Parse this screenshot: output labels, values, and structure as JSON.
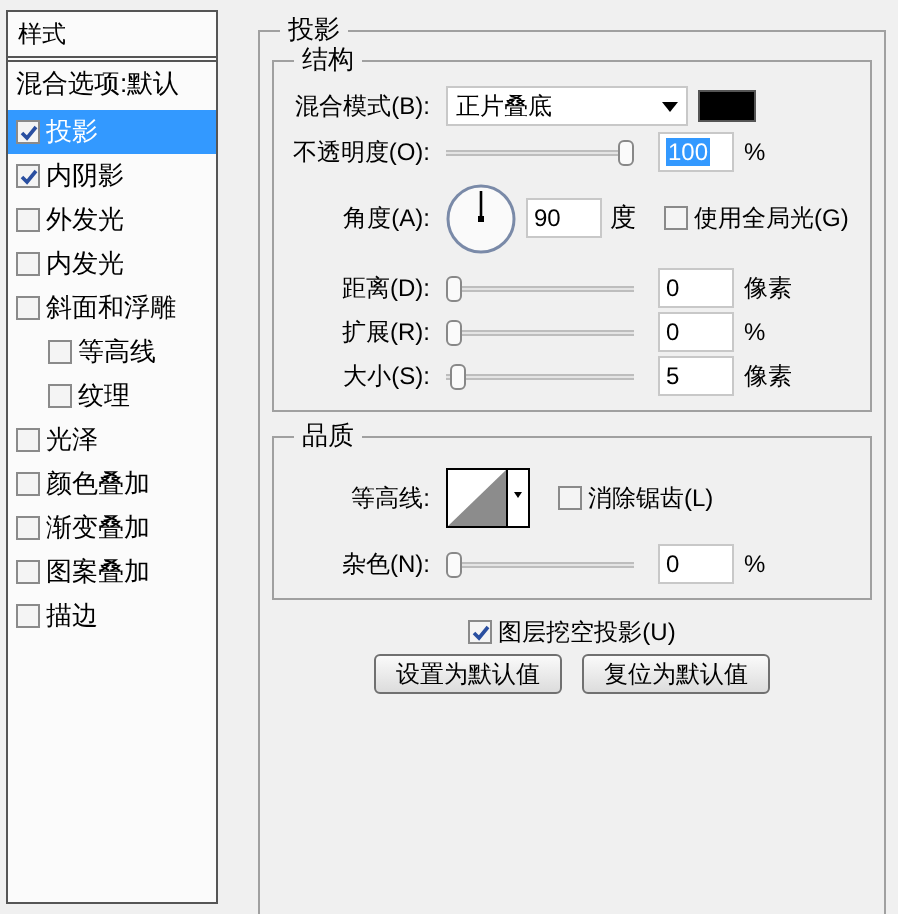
{
  "sidebar": {
    "header": "样式",
    "items": [
      {
        "label": "混合选项:默认",
        "kind": "plain",
        "selected": false
      },
      {
        "label": "投影",
        "kind": "check",
        "checked": true,
        "selected": true
      },
      {
        "label": "内阴影",
        "kind": "check",
        "checked": true,
        "selected": false
      },
      {
        "label": "外发光",
        "kind": "check",
        "checked": false,
        "selected": false
      },
      {
        "label": "内发光",
        "kind": "check",
        "checked": false,
        "selected": false
      },
      {
        "label": "斜面和浮雕",
        "kind": "check",
        "checked": false,
        "selected": false,
        "children": [
          {
            "label": "等高线",
            "kind": "check",
            "checked": false,
            "selected": false
          },
          {
            "label": "纹理",
            "kind": "check",
            "checked": false,
            "selected": false
          }
        ]
      },
      {
        "label": "光泽",
        "kind": "check",
        "checked": false,
        "selected": false
      },
      {
        "label": "颜色叠加",
        "kind": "check",
        "checked": false,
        "selected": false
      },
      {
        "label": "渐变叠加",
        "kind": "check",
        "checked": false,
        "selected": false
      },
      {
        "label": "图案叠加",
        "kind": "check",
        "checked": false,
        "selected": false
      },
      {
        "label": "描边",
        "kind": "check",
        "checked": false,
        "selected": false
      }
    ]
  },
  "panel": {
    "title": "投影",
    "structure": {
      "title": "结构",
      "blend_mode": {
        "label": "混合模式(B):",
        "value": "正片叠底",
        "color": "#000000"
      },
      "opacity": {
        "label": "不透明度(O):",
        "level": 1,
        "value": "100",
        "unit": "%"
      },
      "angle": {
        "label": "角度(A):",
        "value": "90",
        "unit": "度",
        "global_light": {
          "label": "使用全局光(G)",
          "checked": false
        }
      },
      "sliders": [
        {
          "label": "距离(D):",
          "level": 0,
          "value": "0",
          "unit": "像素"
        },
        {
          "label": "扩展(R):",
          "level": 0,
          "value": "0",
          "unit": "%"
        },
        {
          "label": "大小(S):",
          "level": 0.02,
          "value": "5",
          "unit": "像素"
        }
      ]
    },
    "quality": {
      "title": "品质",
      "contour": {
        "label": "等高线:"
      },
      "anti_alias": {
        "label": "消除锯齿(L)",
        "checked": false
      },
      "noise": {
        "label": "杂色(N):",
        "level": 0,
        "value": "0",
        "unit": "%"
      }
    },
    "knockout": {
      "label": "图层挖空投影(U)",
      "checked": true
    },
    "buttons": [
      "设置为默认值",
      "复位为默认值"
    ]
  }
}
